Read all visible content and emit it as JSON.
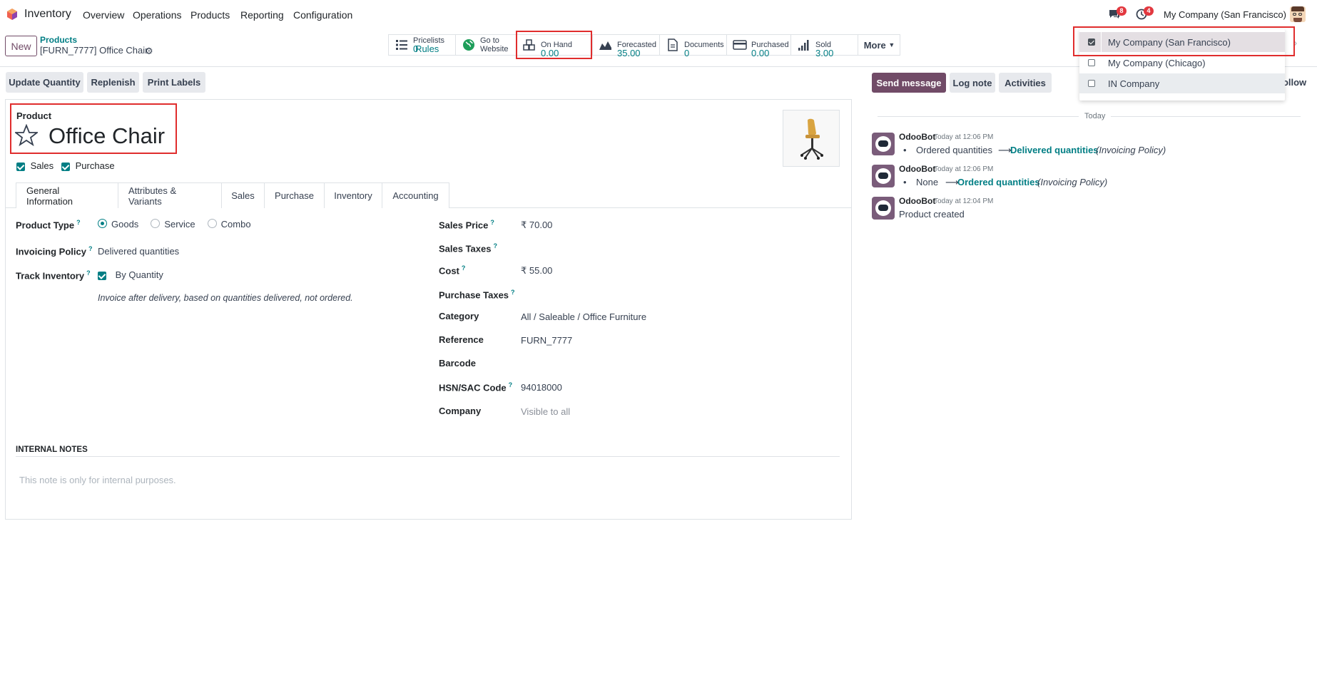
{
  "topnav": {
    "app_name": "Inventory",
    "menu": [
      "Overview",
      "Operations",
      "Products",
      "Reporting",
      "Configuration"
    ],
    "messages_count": "8",
    "activities_count": "4",
    "company": "My Company (San Francisco)"
  },
  "control_panel": {
    "new_label": "New",
    "breadcrumb_parent": "Products",
    "breadcrumb_current": "[FURN_7777] Office Chair",
    "smart_buttons": [
      {
        "label": "Pricelists",
        "value": "0",
        "value2": "Rules"
      },
      {
        "label": "Go to",
        "value": "Website"
      },
      {
        "label": "On Hand",
        "value": "0.00"
      },
      {
        "label": "Forecasted",
        "value": "35.00"
      },
      {
        "label": "Documents",
        "value": "0"
      },
      {
        "label": "Purchased",
        "value": "0.00"
      },
      {
        "label": "Sold",
        "value": "3.00"
      }
    ],
    "more_label": "More"
  },
  "actions": {
    "update_quantity": "Update Quantity",
    "replenish": "Replenish",
    "print_labels": "Print Labels"
  },
  "product": {
    "label": "Product",
    "name": "Office Chair",
    "can_sell_label": "Sales",
    "can_purchase_label": "Purchase",
    "can_sell": true,
    "can_purchase": true
  },
  "tabs": [
    "General Information",
    "Attributes & Variants",
    "Sales",
    "Purchase",
    "Inventory",
    "Accounting"
  ],
  "general": {
    "product_type_label": "Product Type",
    "product_type_options": [
      "Goods",
      "Service",
      "Combo"
    ],
    "product_type_selected": "Goods",
    "invoicing_policy_label": "Invoicing Policy",
    "invoicing_policy_value": "Delivered quantities",
    "track_inventory_label": "Track Inventory",
    "track_inventory_value": "By Quantity",
    "invoice_hint": "Invoice after delivery, based on quantities delivered, not ordered.",
    "sales_price_label": "Sales Price",
    "sales_price_value": "₹ 70.00",
    "sales_taxes_label": "Sales Taxes",
    "cost_label": "Cost",
    "cost_value": "₹ 55.00",
    "purchase_taxes_label": "Purchase Taxes",
    "category_label": "Category",
    "category_value": "All / Saleable / Office Furniture",
    "reference_label": "Reference",
    "reference_value": "FURN_7777",
    "barcode_label": "Barcode",
    "hsn_label": "HSN/SAC Code",
    "hsn_value": "94018000",
    "company_label": "Company",
    "company_placeholder": "Visible to all",
    "notes_heading": "INTERNAL NOTES",
    "notes_placeholder": "This note is only for internal purposes."
  },
  "company_dropdown": {
    "items": [
      {
        "label": "My Company (San Francisco)",
        "checked": true
      },
      {
        "label": "My Company (Chicago)",
        "checked": false
      },
      {
        "label": "IN Company",
        "checked": false
      }
    ]
  },
  "chatter": {
    "send_message": "Send message",
    "log_note": "Log note",
    "activities": "Activities",
    "follow": "Follow",
    "day_separator": "Today",
    "messages": [
      {
        "author": "OdooBot",
        "time": "Today at 12:06 PM",
        "old": "Ordered quantities",
        "new": "Delivered quantities",
        "field": "(Invoicing Policy)"
      },
      {
        "author": "OdooBot",
        "time": "Today at 12:06 PM",
        "old": "None",
        "new": "Ordered quantities",
        "field": "(Invoicing Policy)"
      },
      {
        "author": "OdooBot",
        "time": "Today at 12:04 PM",
        "body": "Product created"
      }
    ]
  },
  "colors": {
    "brand": "#714b67",
    "link": "#017e84",
    "highlight": "#e02d2d"
  }
}
